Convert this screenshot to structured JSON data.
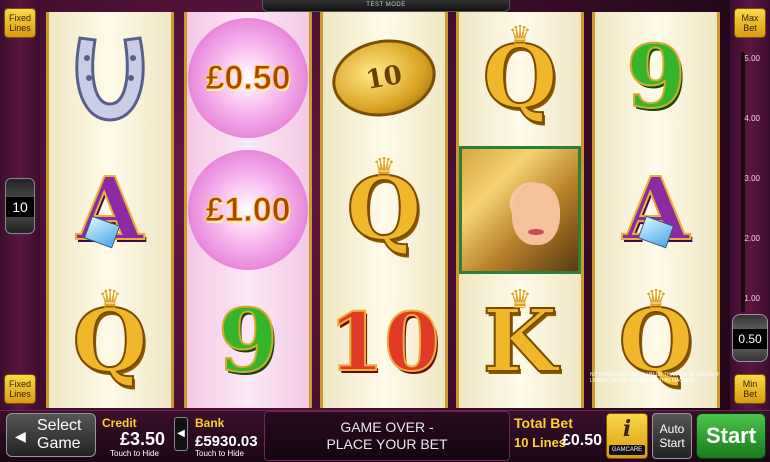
{
  "header": {
    "mode_text": "TEST MODE"
  },
  "left_panel": {
    "fixed_lines_top": [
      "Fixed",
      "Lines"
    ],
    "fixed_lines_bottom": [
      "Fixed",
      "Lines"
    ],
    "lines_value": "10"
  },
  "right_panel": {
    "max_bet": [
      "Max",
      "Bet"
    ],
    "min_bet": [
      "Min",
      "Bet"
    ],
    "scale_ticks": [
      "5.00",
      "4.00",
      "3.00",
      "2.00",
      "1.00"
    ],
    "bet_value": "0.50"
  },
  "reels": [
    {
      "symbols": [
        "horseshoe",
        "A",
        "Q"
      ],
      "style": "plain"
    },
    {
      "symbols": [
        "£0.50",
        "£1.00",
        "9"
      ],
      "style": "pink"
    },
    {
      "symbols": [
        "10",
        "Q",
        "10"
      ],
      "style": "plain"
    },
    {
      "symbols": [
        "Q",
        "lady",
        "K"
      ],
      "style": "plain"
    },
    {
      "symbols": [
        "9",
        "A",
        "Q"
      ],
      "style": "plain"
    }
  ],
  "symbols": {
    "coin_number": "10",
    "prize_1": "£0.50",
    "prize_2": "£1.00"
  },
  "fineprint": "NO PRIZE GREATER IN VALUE THAN £10.00 (£20.00) IF LINKED CAN BE WON FROM THIS MACHINE",
  "bottom_bar": {
    "select_game": [
      "Select",
      "Game"
    ],
    "credit_label": "Credit",
    "credit_value": "£3.50",
    "credit_hint": "Touch to Hide",
    "bank_label": "Bank",
    "bank_value": "£5930.03",
    "bank_hint": "Touch to Hide",
    "message": [
      "GAME OVER -",
      "PLACE YOUR BET"
    ],
    "total_bet_label": "Total Bet",
    "lines_text": "10 Lines",
    "total_bet_value": "£0.50",
    "info_symbol": "i",
    "gamcare_text": "GAMCARE",
    "auto_start": [
      "Auto",
      "Start"
    ],
    "start_label": "Start"
  },
  "colors": {
    "accent_yellow": "#ffd22a",
    "start_green": "#37b52a",
    "background_magenta": "#6b1a4a"
  }
}
